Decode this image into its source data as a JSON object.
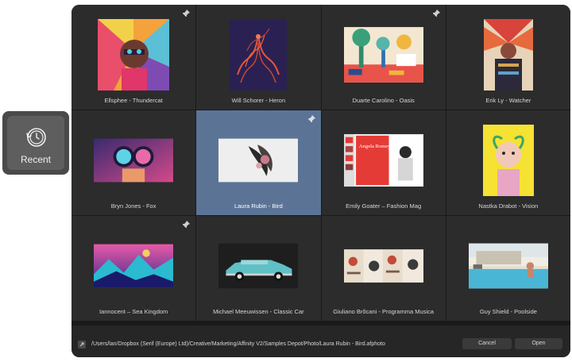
{
  "items": [
    {
      "caption": "Ellsphee - Thundercat"
    },
    {
      "caption": "Will Schorer - Heron"
    },
    {
      "caption": "Duarte Carolino - Oasis"
    },
    {
      "caption": "Erik Ly - Watcher"
    },
    {
      "caption": "Bryn Jones - Fox"
    },
    {
      "caption": "Laura Rubin - Bird"
    },
    {
      "caption": "Emily Goater – Fashion Mag"
    },
    {
      "caption": "Nastka Drabot - Vision"
    },
    {
      "caption": "Iannocent – Sea Kingdom"
    },
    {
      "caption": "Michael Meeuwissen - Classic Car"
    },
    {
      "caption": "Giuliano Brõcani - Programma Musica"
    },
    {
      "caption": "Guy Shield - Poolside"
    }
  ],
  "thumb_text": {
    "fashion_title": "Angela Romey"
  },
  "footer": {
    "path": "/Users/lan/Dropbox (Serif (Europe) Ltd)/Creative/Marketing/Affinity V2/Samples Depot/Photo/Laura Rubin - Bird.afphoto",
    "cancel_label": "Cancel",
    "open_label": "Open"
  },
  "sidebar": {
    "recent_label": "Recent"
  },
  "colors": {
    "panel_bg": "#262626",
    "selected_bg": "#5b7496",
    "button_bg": "#3a3a3a"
  }
}
